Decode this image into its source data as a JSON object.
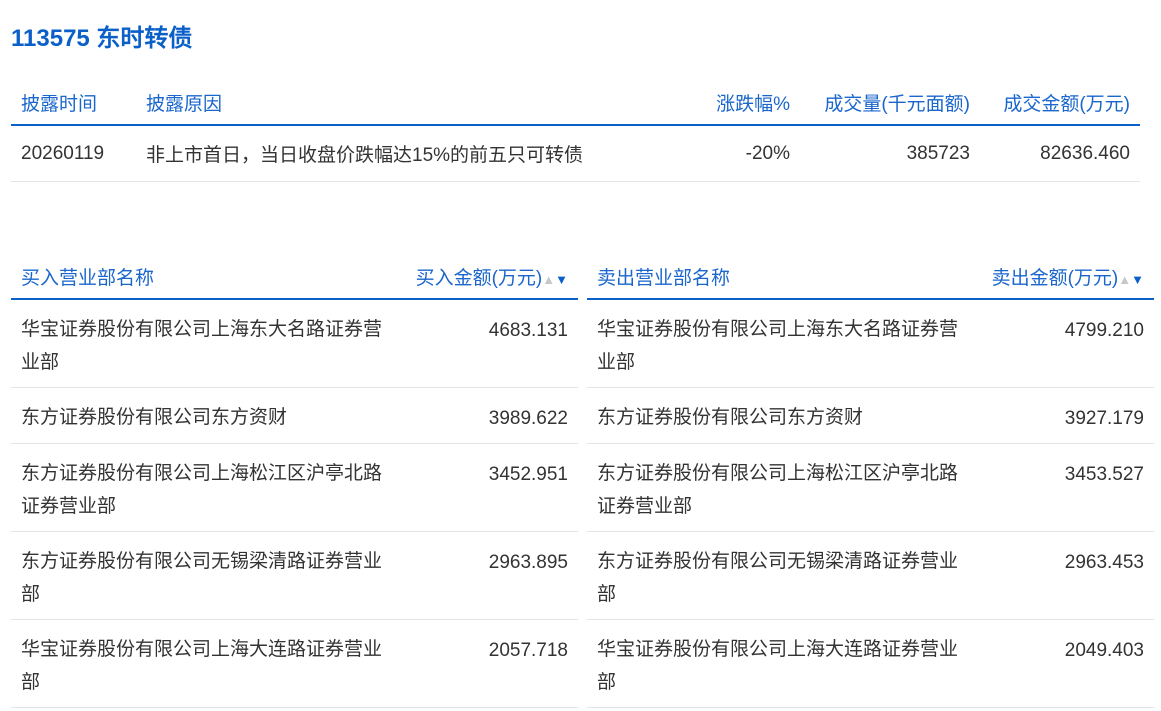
{
  "title": "113575 东时转债",
  "disclosure": {
    "headers": [
      "披露时间",
      "披露原因",
      "涨跌幅%",
      "成交量(千元面额)",
      "成交金额(万元)"
    ],
    "rows": [
      [
        "20260119",
        "非上市首日，当日收盘价跌幅达15%的前五只可转债",
        "-20%",
        "385723",
        "82636.460"
      ]
    ]
  },
  "buy": {
    "headers": [
      "买入营业部名称",
      "买入金额(万元)"
    ],
    "rows": [
      [
        "华宝证券股份有限公司上海东大名路证券营业部",
        "4683.131"
      ],
      [
        "东方证券股份有限公司东方资财",
        "3989.622"
      ],
      [
        "东方证券股份有限公司上海松江区沪亭北路证券营业部",
        "3452.951"
      ],
      [
        "东方证券股份有限公司无锡梁清路证券营业部",
        "2963.895"
      ],
      [
        "华宝证券股份有限公司上海大连路证券营业部",
        "2057.718"
      ]
    ]
  },
  "sell": {
    "headers": [
      "卖出营业部名称",
      "卖出金额(万元)"
    ],
    "rows": [
      [
        "华宝证券股份有限公司上海东大名路证券营业部",
        "4799.210"
      ],
      [
        "东方证券股份有限公司东方资财",
        "3927.179"
      ],
      [
        "东方证券股份有限公司上海松江区沪亭北路证券营业部",
        "3453.527"
      ],
      [
        "东方证券股份有限公司无锡梁清路证券营业部",
        "2963.453"
      ],
      [
        "华宝证券股份有限公司上海大连路证券营业部",
        "2049.403"
      ]
    ]
  },
  "sort_icons": {
    "up": "▲",
    "down": "▼"
  }
}
